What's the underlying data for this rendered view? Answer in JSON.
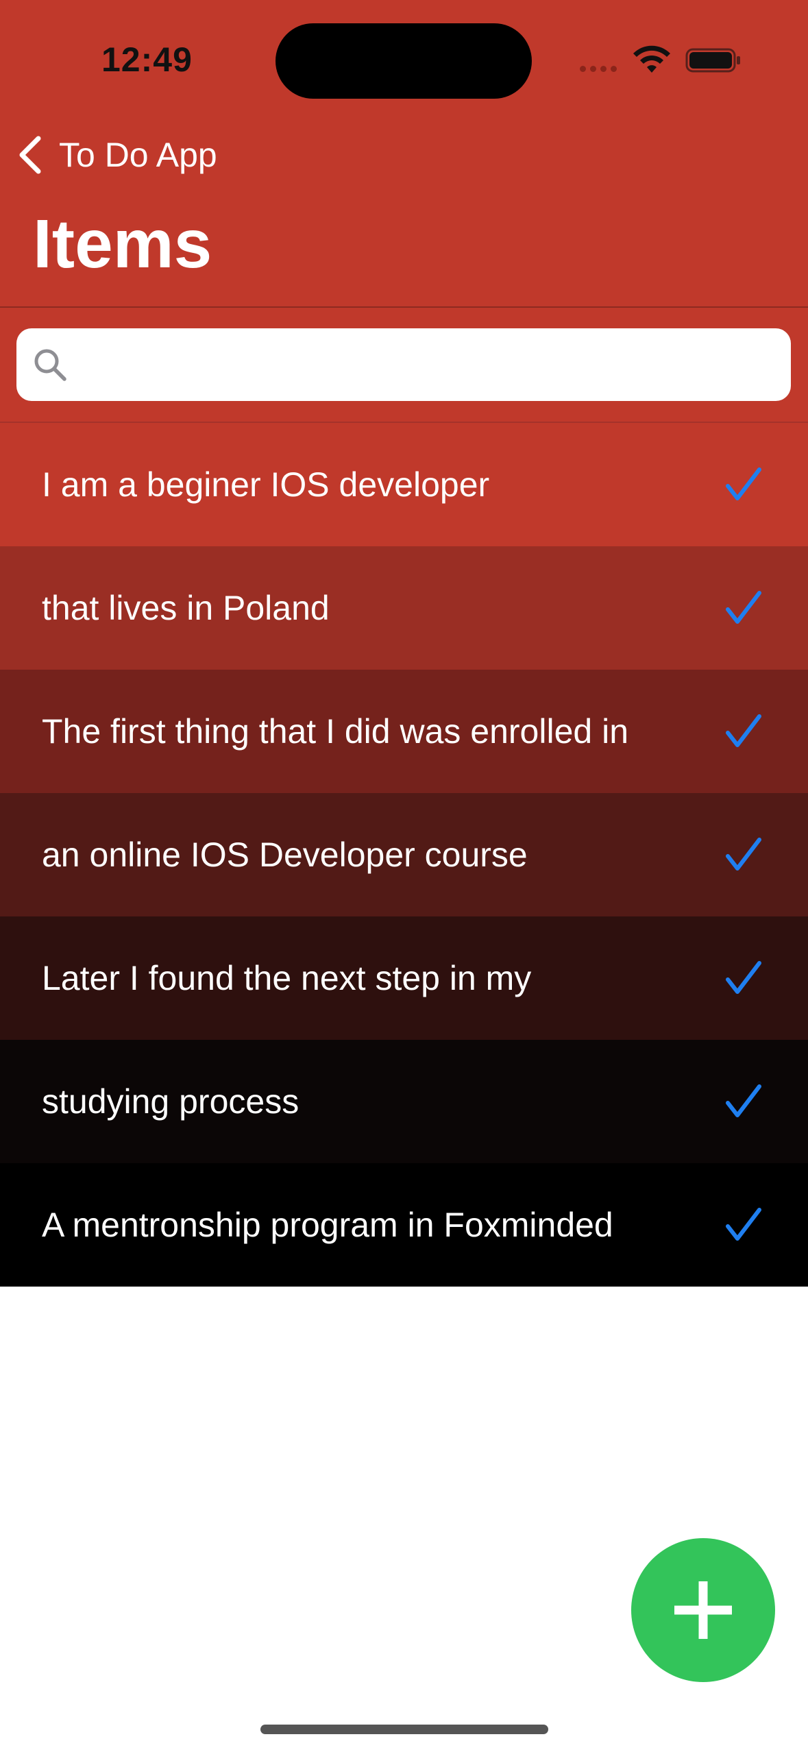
{
  "status_bar": {
    "time": "12:49"
  },
  "nav": {
    "back_label": "To Do App",
    "title": "Items"
  },
  "search": {
    "placeholder": "",
    "value": ""
  },
  "items": [
    {
      "label": "I am a beginer IOS developer",
      "checked": true,
      "bg": "#c0392b"
    },
    {
      "label": "that lives in Poland",
      "checked": true,
      "bg": "#9a2e24"
    },
    {
      "label": "The first thing that I did was enrolled in",
      "checked": true,
      "bg": "#75221c"
    },
    {
      "label": "an online IOS Developer course",
      "checked": true,
      "bg": "#521a16"
    },
    {
      "label": "Later I found the next step in my",
      "checked": true,
      "bg": "#2e100e"
    },
    {
      "label": "studying process",
      "checked": true,
      "bg": "#0b0606"
    },
    {
      "label": "A mentronship program in Foxminded",
      "checked": true,
      "bg": "#000000"
    }
  ],
  "colors": {
    "nav_bar": "#c0392b",
    "check": "#1f7ff0",
    "add_button": "#33c45a"
  },
  "icons": {
    "back": "chevron-left-icon",
    "search": "magnifier-icon",
    "check": "checkmark-icon",
    "add": "plus-icon"
  }
}
